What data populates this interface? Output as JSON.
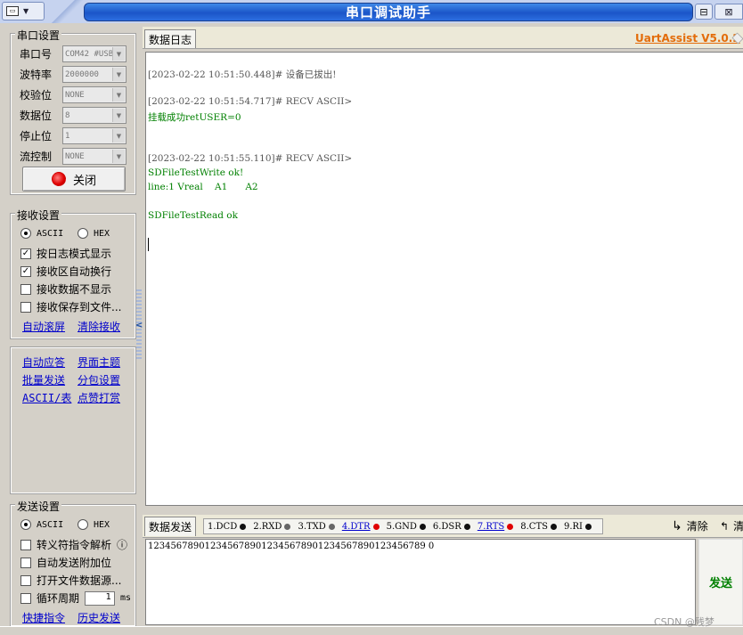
{
  "window": {
    "title": "串口调试助手",
    "sysmenu_icon": "app-icon",
    "pin_glyph": "⊟",
    "close_glyph": "⊠"
  },
  "serial_settings": {
    "title": "串口设置",
    "rows": [
      {
        "label": "串口号",
        "value": "COM42 #USB-SERIAL"
      },
      {
        "label": "波特率",
        "value": "2000000"
      },
      {
        "label": "校验位",
        "value": "NONE"
      },
      {
        "label": "数据位",
        "value": "8"
      },
      {
        "label": "停止位",
        "value": "1"
      },
      {
        "label": "流控制",
        "value": "NONE"
      }
    ],
    "close_button": "关闭"
  },
  "receive_settings": {
    "title": "接收设置",
    "ascii": "ASCII",
    "hex": "HEX",
    "options": [
      {
        "label": "按日志模式显示",
        "checked": true
      },
      {
        "label": "接收区自动换行",
        "checked": true
      },
      {
        "label": "接收数据不显示",
        "checked": false
      },
      {
        "label": "接收保存到文件...",
        "checked": false
      }
    ],
    "auto_scroll": "自动滚屏",
    "clear_receive": "清除接收"
  },
  "tools": {
    "auto_reply": "自动应答",
    "theme": "界面主题",
    "batch_send": "批量发送",
    "packet_settings": "分包设置",
    "ascii_table": "ASCII/表",
    "tip": "点赞打赏"
  },
  "send_settings": {
    "title": "发送设置",
    "ascii": "ASCII",
    "hex": "HEX",
    "options": [
      {
        "label": "转义符指令解析"
      },
      {
        "label": "自动发送附加位"
      },
      {
        "label": "打开文件数据源..."
      }
    ],
    "loop_label": "循环周期",
    "loop_value": "1",
    "loop_unit": "ms",
    "shortcuts": "快捷指令",
    "history": "历史发送",
    "info_glyph": "ⓘ"
  },
  "log": {
    "tab": "数据日志",
    "brand": "UartAssist V5.0.2",
    "lines": [
      {
        "kind": "hdr",
        "text": "[2023-02-22 10:51:50.448]# 设备已拔出!"
      },
      {
        "kind": "hdr",
        "text": "[2023-02-22 10:51:54.717]# RECV ASCII>"
      },
      {
        "kind": "dat",
        "text": "挂载成功retUSER=0"
      },
      {
        "kind": "hdr",
        "text": "[2023-02-22 10:51:55.110]# RECV ASCII>"
      },
      {
        "kind": "dat",
        "text": "SDFileTestWrite ok!"
      },
      {
        "kind": "dat",
        "text": "line:1 Vreal    A1      A2"
      },
      {
        "kind": "dat",
        "text": "SDFileTestRead ok"
      }
    ]
  },
  "send": {
    "tab": "数据发送",
    "pins": [
      {
        "label": "1.DCD",
        "led": "black",
        "link": false
      },
      {
        "label": "2.RXD",
        "led": "gray",
        "link": false
      },
      {
        "label": "3.TXD",
        "led": "gray",
        "link": false
      },
      {
        "label": "4.DTR",
        "led": "red",
        "link": true
      },
      {
        "label": "5.GND",
        "led": "black",
        "link": false
      },
      {
        "label": "6.DSR",
        "led": "black",
        "link": false
      },
      {
        "label": "7.RTS",
        "led": "red",
        "link": true
      },
      {
        "label": "8.CTS",
        "led": "black",
        "link": false
      },
      {
        "label": "9.RI",
        "led": "black",
        "link": false
      }
    ],
    "clear": "清除",
    "clear2": "清",
    "text": "1234567890123456789012345678901234567890123456789 0",
    "button": "发送"
  },
  "watermark": "CSDN @残梦"
}
